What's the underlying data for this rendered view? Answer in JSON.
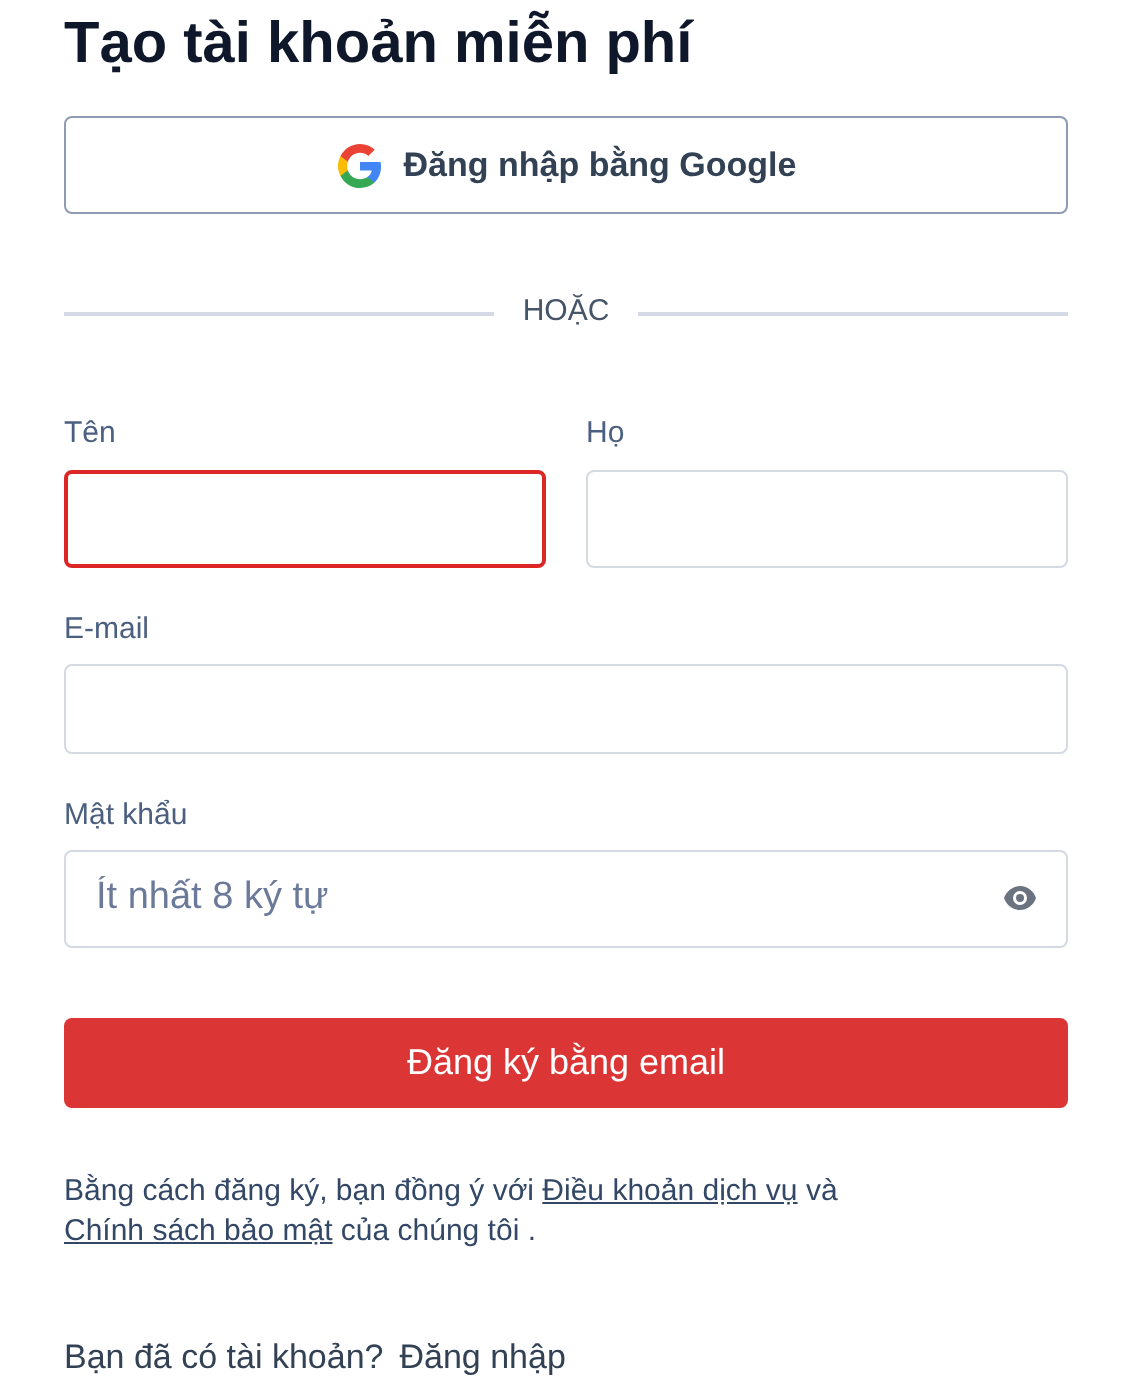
{
  "title": "Tạo tài khoản miễn phí",
  "google_button": {
    "label": "Đăng nhập bằng Google"
  },
  "divider": {
    "label": "HOẶC"
  },
  "name_fields": [
    {
      "label": "Tên",
      "invalid": true
    },
    {
      "label": "Họ",
      "invalid": false
    }
  ],
  "email_field": {
    "label": "E-mail",
    "invalid": false
  },
  "password_field": {
    "label": "Mật khẩu",
    "placeholder": "Ít nhất 8 ký tự",
    "invalid": false
  },
  "submit_button": {
    "label": "Đăng ký bằng email"
  },
  "terms": {
    "before": "Bằng cách đăng ký, bạn đồng ý với",
    "terms_link": "Điều khoản dịch vụ",
    "middle": "và",
    "privacy_link": "Chính sách bảo mật",
    "after": "của chúng tôi ."
  },
  "login_prompt": {
    "text": "Bạn đã có tài khoản?",
    "link": "Đăng nhập"
  }
}
